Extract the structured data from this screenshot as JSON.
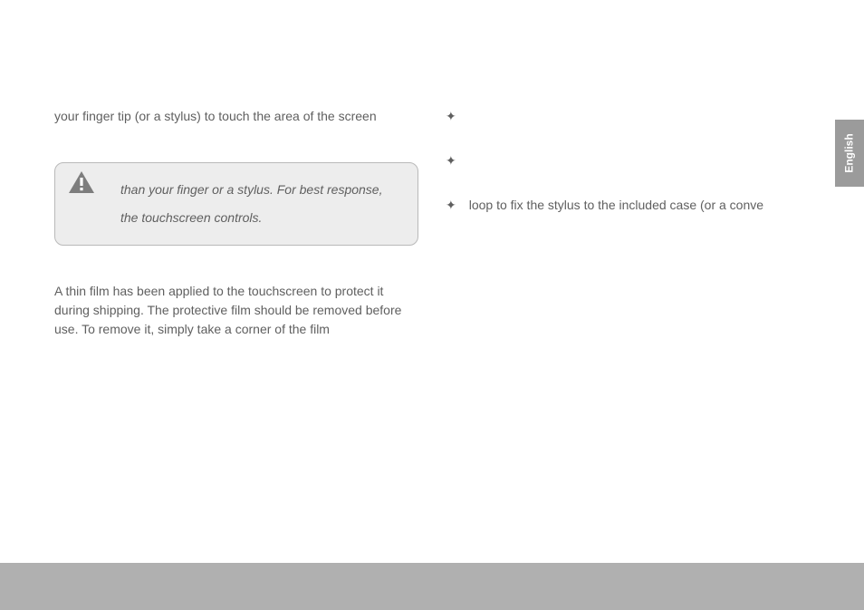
{
  "sideTab": "English",
  "left": {
    "topLine": "your finger tip (or a stylus) to touch the area of the screen",
    "calloutLine1": "than your finger or a stylus. For best response,",
    "calloutLine2": "the touchscreen controls.",
    "bottomPara": "A thin film has been applied to the touchscreen to protect it during shipping. The protective film should be removed before use. To remove it, simply take a corner of the film"
  },
  "right": {
    "bullet3": "loop to fix the stylus to the included case (or a conve"
  }
}
